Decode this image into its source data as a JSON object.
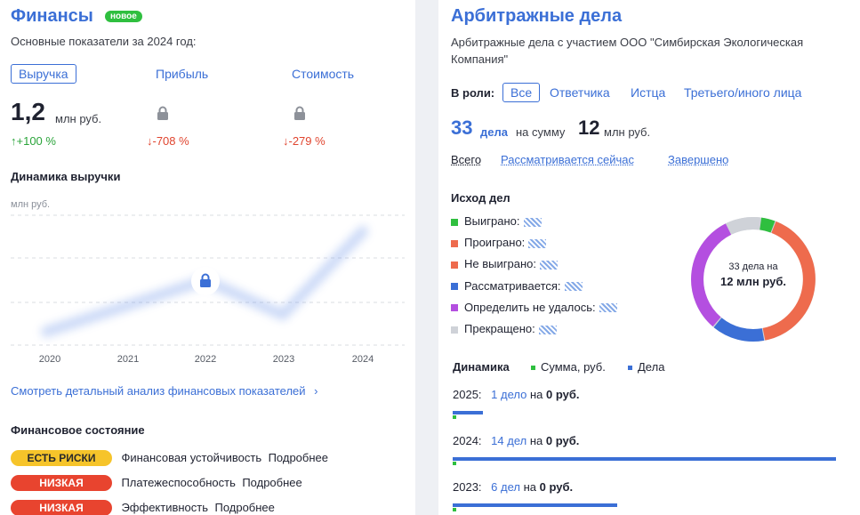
{
  "finance": {
    "title": "Финансы",
    "badge": "новое",
    "subtitle": "Основные показатели за 2024 год:",
    "tabs": [
      "Выручка",
      "Прибыль",
      "Стоимость"
    ],
    "revenue_value": "1,2",
    "revenue_unit": "млн руб.",
    "revenue_change": "↑+100 %",
    "profit_change": "↓-708 %",
    "cost_change": "↓-279 %",
    "chart_title": "Динамика выручки",
    "analysis_link": "Смотреть детальный анализ финансовых показателей",
    "state_title": "Финансовое состояние",
    "states": [
      {
        "badge": "ЕСТЬ РИСКИ",
        "label": "Финансовая устойчивость",
        "link": "Подробнее"
      },
      {
        "badge": "НИЗКАЯ",
        "label": "Платежеспособность",
        "link": "Подробнее"
      },
      {
        "badge": "НИЗКАЯ",
        "label": "Эффективность",
        "link": "Подробнее"
      }
    ]
  },
  "chart_data": {
    "type": "line",
    "title": "Динамика выручки",
    "ylabel": "млн руб.",
    "categories": [
      "2020",
      "2021",
      "2022",
      "2023",
      "2024"
    ],
    "note": "values hidden (blurred, locked)",
    "locked": true
  },
  "arbitration": {
    "title": "Арбитражные дела",
    "subtitle": "Арбитражные дела с участием ООО \"Симбирская Экологическая Компания\"",
    "role_label": "В роли:",
    "roles": [
      "Все",
      "Ответчика",
      "Истца",
      "Третьего/иного лица"
    ],
    "count": "33",
    "count_unit": "дела",
    "sum_label": "на сумму",
    "sum_value": "12",
    "sum_unit": "млн руб.",
    "filters": [
      "Всего",
      "Рассматривается сейчас",
      "Завершено"
    ],
    "outcome_title": "Исход дел",
    "outcomes": [
      {
        "label": "Выиграно:",
        "color": "#2fbf3f"
      },
      {
        "label": "Проиграно:",
        "color": "#ee6b4d"
      },
      {
        "label": "Не выиграно:",
        "color": "#ee6b4d"
      },
      {
        "label": "Рассматривается:",
        "color": "#3b6fd6"
      },
      {
        "label": "Определить не удалось:",
        "color": "#b44fe0"
      },
      {
        "label": "Прекращено:",
        "color": "#cfd2d8"
      }
    ],
    "donut_line1": "33 дела на",
    "donut_line2": "12 млн руб.",
    "dynamics_title": "Динамика",
    "legend_sum": "Сумма, руб.",
    "legend_cases": "Дела",
    "years": [
      {
        "year": "2025:",
        "cases": "1 дело",
        "on": "на",
        "sum": "0 руб."
      },
      {
        "year": "2024:",
        "cases": "14 дел",
        "on": "на",
        "sum": "0 руб."
      },
      {
        "year": "2023:",
        "cases": "6 дел",
        "on": "на",
        "sum": "0 руб."
      }
    ]
  }
}
